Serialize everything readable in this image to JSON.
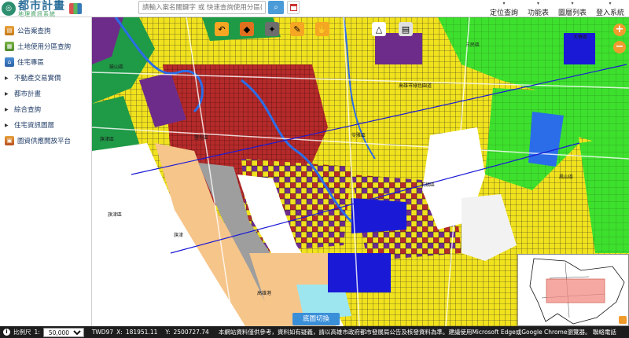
{
  "header": {
    "logo_title": "都市計畫",
    "logo_subtitle": "地理資訊系統",
    "search_placeholder": "請輸入案名關鍵字 或 快速查詢使用分區(U,地號)",
    "nav": [
      {
        "label": "定位查詢",
        "icon": "chevron-down-icon"
      },
      {
        "label": "功能表",
        "icon": "chevron-down-icon"
      },
      {
        "label": "圖層列表",
        "icon": "chevron-down-icon"
      },
      {
        "label": "登入系統",
        "icon": "chevron-down-icon"
      }
    ]
  },
  "sidebar": {
    "items": [
      {
        "label": "公告案查詢",
        "icon": "case-query-icon"
      },
      {
        "label": "土地使用分區查詢",
        "icon": "zoning-query-icon"
      },
      {
        "label": "住宅專區",
        "icon": "housing-icon"
      },
      {
        "label": "不動產交易實價",
        "icon": "chevron-right-icon"
      },
      {
        "label": "都市計畫",
        "icon": "chevron-right-icon"
      },
      {
        "label": "綜合查詢",
        "icon": "chevron-right-icon"
      },
      {
        "label": "住宅資訊圖層",
        "icon": "chevron-right-icon"
      },
      {
        "label": "圖資供應開放平台",
        "icon": "platform-icon"
      }
    ]
  },
  "map": {
    "tools": [
      "back-icon",
      "eraser-icon",
      "locate-icon",
      "measure-icon",
      "pan-hand-icon",
      "draw-polygon-icon",
      "print-icon"
    ],
    "labels": [
      {
        "text": "鼓山區"
      },
      {
        "text": "鹽埕區"
      },
      {
        "text": "旗津區"
      },
      {
        "text": "苓雅區"
      },
      {
        "text": "鳳山區"
      },
      {
        "text": "前鎮區"
      },
      {
        "text": "三民區"
      },
      {
        "text": "高雄市綠色園道"
      },
      {
        "text": "大寮區"
      },
      {
        "text": "高雄港"
      },
      {
        "text": "旗津區"
      },
      {
        "text": "旗津"
      }
    ],
    "basemap_button": "底圖切換",
    "colors": {
      "residential": "#f1e21e",
      "commercial": "#b52a2a",
      "park": "#3ee02e",
      "green": "#1f9a47",
      "industrial": "#6e2c8a",
      "water": "#2b6de8",
      "public": "#1a1ad6",
      "port": "#f6c58a"
    }
  },
  "status": {
    "scale_label": "比例尺",
    "scale_prefix": "1:",
    "scale_value": "50,000",
    "crs": "TWD97",
    "x_label": "X:",
    "x_value": "181951.11",
    "y_label": "Y:",
    "y_value": "2500727.74",
    "notice": "本網站資料僅供參考，資料如有疑義，請以高雄市政府都市發展局公告及核發資料為準。建議使用Microsoft Edge或Google Chrome瀏覽器。 聯絡電話"
  }
}
